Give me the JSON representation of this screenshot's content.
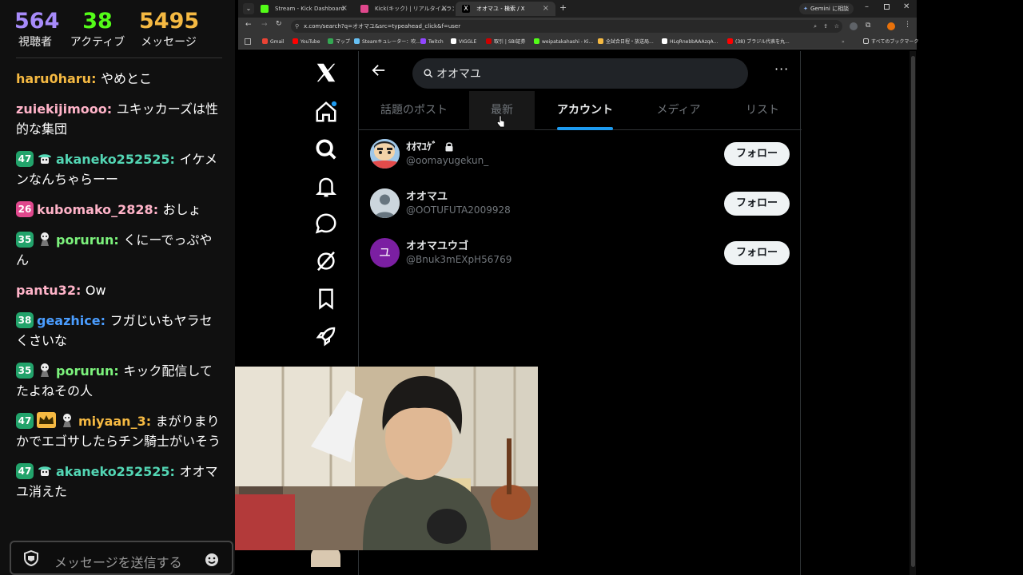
{
  "chat": {
    "stats": [
      {
        "value": "564",
        "label": "視聴者",
        "color": "#a78bfa"
      },
      {
        "value": "38",
        "label": "アクティブ",
        "color": "#53fc18"
      },
      {
        "value": "5495",
        "label": "メッセージ",
        "color": "#f5b942"
      }
    ],
    "messages": [
      {
        "badge": "",
        "user": "haru0haru",
        "user_color": "#f5b942",
        "text": "やめとこ"
      },
      {
        "badge": "",
        "user": "zuiekijimooo",
        "user_color": "#ffb3c8",
        "text": "ユキッカーズは性的な集団"
      },
      {
        "badge": "47",
        "badge_color": "#22a36b",
        "emote": "green-robot-icon",
        "user": "akaneko252525",
        "user_color": "#53d6b4",
        "text": "イケメンなんちゃらーー"
      },
      {
        "badge": "26",
        "badge_color": "#e0488d",
        "user": "kubomako_2828",
        "user_color": "#ffb3c8",
        "text": "おしょ"
      },
      {
        "badge": "35",
        "badge_color": "#22a36b",
        "emote": "doll-icon",
        "user": "porurun",
        "user_color": "#7cf27c",
        "text": "くにーでっぷやん"
      },
      {
        "badge": "",
        "user": "pantu32",
        "user_color": "#ffb3c8",
        "text": "Ow"
      },
      {
        "badge": "38",
        "badge_color": "#22a36b",
        "user": "geazhice",
        "user_color": "#4a9dff",
        "text": "フガじいもヤラセくさいな"
      },
      {
        "badge": "35",
        "badge_color": "#22a36b",
        "emote": "doll-icon",
        "user": "porurun",
        "user_color": "#7cf27c",
        "text": "キック配信してたよねその人"
      },
      {
        "badge": "47",
        "badge_color": "#22a36b",
        "crown": true,
        "emote": "doll-icon",
        "user": "miyaan_3",
        "user_color": "#f5b942",
        "text": "まがりまりかでエゴサしたらチン騎士がいそう"
      },
      {
        "badge": "47",
        "badge_color": "#22a36b",
        "emote": "green-robot-icon",
        "user": "akaneko252525",
        "user_color": "#53d6b4",
        "text": "オオマユ消えた"
      }
    ],
    "input_placeholder": "メッセージを送信する"
  },
  "browser": {
    "tabs": [
      {
        "label": "Stream - Kick Dashboard",
        "fav_color": "#53fc18",
        "active": false
      },
      {
        "label": "Kick(キック) | リアルタイムランキング",
        "fav_color": "#e0488d",
        "active": false
      },
      {
        "label": "オオマユ - 検索 / X",
        "fav_color": "#ffffff",
        "active": true
      }
    ],
    "gemini_label": "Gemini に相談",
    "url": "x.com/search?q=オオマユ&src=typeahead_click&f=user",
    "bookmarks": [
      "Gmail",
      "YouTube",
      "マップ",
      "Steamキュレーター：吹...",
      "Twitch",
      "VIGGLE",
      "取引 | SBI証券",
      "weipatakahashi - Ki...",
      "全試合日程・放送局...",
      "HLqRnebbAAAzqA...",
      "(38) ブラジル代表を丸...",
      "すべてのブックマーク"
    ]
  },
  "x": {
    "search_query": "オオマユ",
    "tabs": [
      "話題のポスト",
      "最新",
      "アカウント",
      "メディア",
      "リスト"
    ],
    "active_tab": "アカウント",
    "accounts": [
      {
        "name": "ｵｵﾏﾕｹﾞ",
        "handle": "@oomayugekun_",
        "locked": true,
        "avatar": "cartoon",
        "follow": "フォロー"
      },
      {
        "name": "オオマユ",
        "handle": "@OOTUFUTA2009928",
        "locked": false,
        "avatar": "default",
        "follow": "フォロー"
      },
      {
        "name": "オオマユウゴ",
        "handle": "@Bnuk3mEXpH56769",
        "locked": false,
        "avatar": "letter",
        "avatar_letter": "ユ",
        "avatar_color": "#7b1fa2",
        "follow": "フォロー"
      }
    ]
  }
}
